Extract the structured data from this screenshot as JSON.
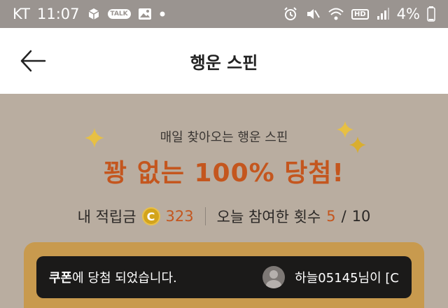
{
  "status_bar": {
    "carrier": "KT",
    "time": "11:07",
    "talk_badge": "TALK",
    "hd_badge": "HD",
    "battery": "4%"
  },
  "header": {
    "title": "행운 스핀"
  },
  "promo": {
    "subtitle": "매일 찾아오는 행운 스핀",
    "headline": "꽝 없는 100% 당첨!"
  },
  "stats": {
    "points_label": "내 적립금",
    "coin_symbol": "C",
    "points_value": "323",
    "participation_label": "오늘 참여한 횟수",
    "participation_count": "5",
    "participation_separator": "/",
    "participation_max": "10"
  },
  "notice": {
    "prize_word": "쿠폰",
    "message_rest": "에 당첨 되었습니다.",
    "winner_text": "하늘05145님이 [C"
  },
  "colors": {
    "accent_orange": "#c4561e",
    "coin_gold": "#d3a41c",
    "background": "#b9ada0",
    "panel": "#c89a4e"
  }
}
